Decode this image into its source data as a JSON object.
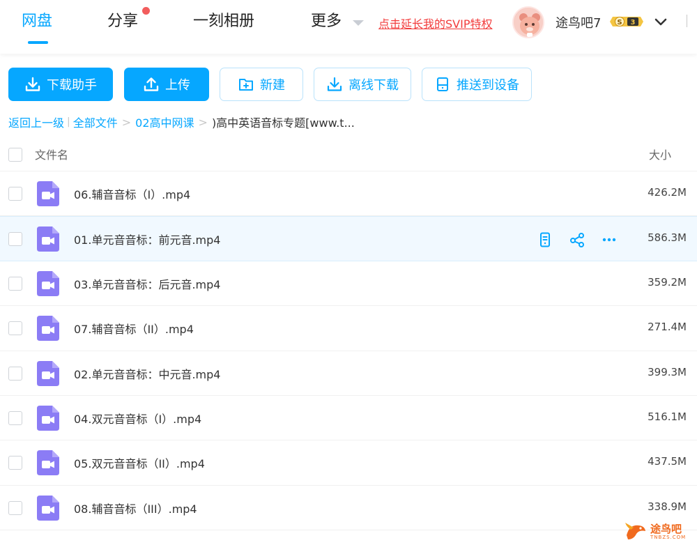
{
  "nav": {
    "tabs": [
      "网盘",
      "分享",
      "一刻相册",
      "更多"
    ],
    "svip_link": "点击延长我的SVIP特权",
    "username": "途鸟吧7",
    "vip_level": "3",
    "vip_letter": "S",
    "accent_color": "#06a7ff"
  },
  "toolbar": {
    "download_helper": "下载助手",
    "upload": "上传",
    "new_folder": "新建",
    "offline_download": "离线下载",
    "push_to_device": "推送到设备"
  },
  "breadcrumb": {
    "back": "返回上一级",
    "all_files": "全部文件",
    "folder": "02高中网课",
    "current": ")高中英语音标专题[www.t..."
  },
  "table": {
    "col_name": "文件名",
    "col_size": "大小",
    "rows": [
      {
        "name": "06.辅音音标（I）.mp4",
        "size": "426.2M"
      },
      {
        "name": "01.单元音音标：前元音.mp4",
        "size": "586.3M"
      },
      {
        "name": "03.单元音音标：后元音.mp4",
        "size": "359.2M"
      },
      {
        "name": "07.辅音音标（II）.mp4",
        "size": "271.4M"
      },
      {
        "name": "02.单元音音标：中元音.mp4",
        "size": "399.3M"
      },
      {
        "name": "04.双元音音标（I）.mp4",
        "size": "516.1M"
      },
      {
        "name": "05.双元音音标（II）.mp4",
        "size": "437.5M"
      },
      {
        "name": "08.辅音音标（III）.mp4",
        "size": "338.9M"
      }
    ]
  },
  "watermark": {
    "text": "途鸟吧",
    "sub": "TNBZS.COM"
  }
}
